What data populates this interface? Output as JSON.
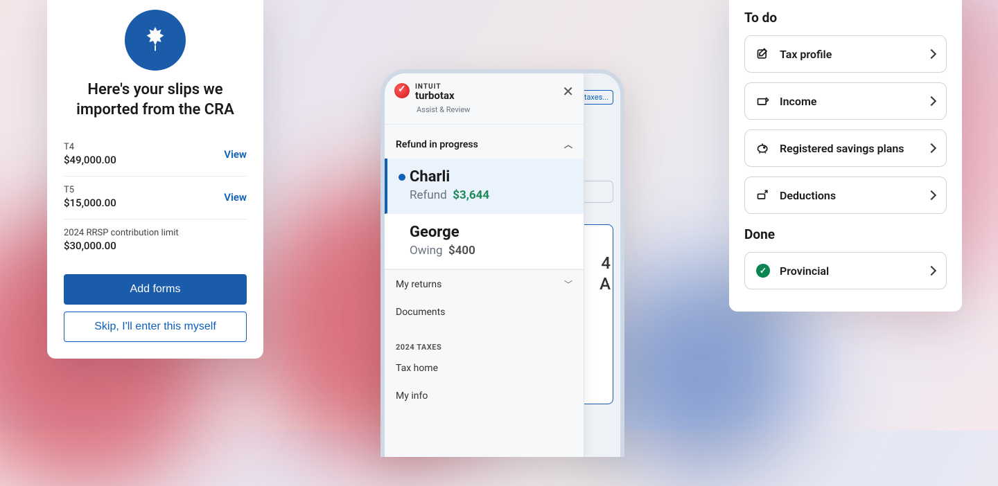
{
  "cra_card": {
    "title": "Here's your slips we imported from the CRA",
    "slips": [
      {
        "label": "T4",
        "amount": "$49,000.00",
        "action": "View"
      },
      {
        "label": "T5",
        "amount": "$15,000.00",
        "action": "View"
      },
      {
        "label": "2024 RRSP contribution limit",
        "amount": "$30,000.00",
        "action": ""
      }
    ],
    "add_forms_label": "Add forms",
    "skip_label": "Skip, I'll enter this myself"
  },
  "phone": {
    "brand_top": "INTUIT",
    "brand": "turbotax",
    "subtitle": "Assist & Review",
    "taxes_chip": "taxes...",
    "refund_section": "Refund in progress",
    "people": [
      {
        "name": "Charli",
        "status_label": "Refund",
        "amount": "$3,644",
        "type": "refund"
      },
      {
        "name": "George",
        "status_label": "Owing",
        "amount": "$400",
        "type": "owing"
      }
    ],
    "my_returns": "My returns",
    "documents": "Documents",
    "tax_year_label": "2024 TAXES",
    "tax_home": "Tax home",
    "my_info": "My info",
    "peek1": "4",
    "peek2": "A"
  },
  "tasks": {
    "todo_title": "To do",
    "done_title": "Done",
    "todo": [
      {
        "label": "Tax profile",
        "icon": "edit"
      },
      {
        "label": "Income",
        "icon": "income"
      },
      {
        "label": "Registered savings plans",
        "icon": "piggy"
      },
      {
        "label": "Deductions",
        "icon": "deduct"
      }
    ],
    "done": [
      {
        "label": "Provincial"
      }
    ]
  }
}
